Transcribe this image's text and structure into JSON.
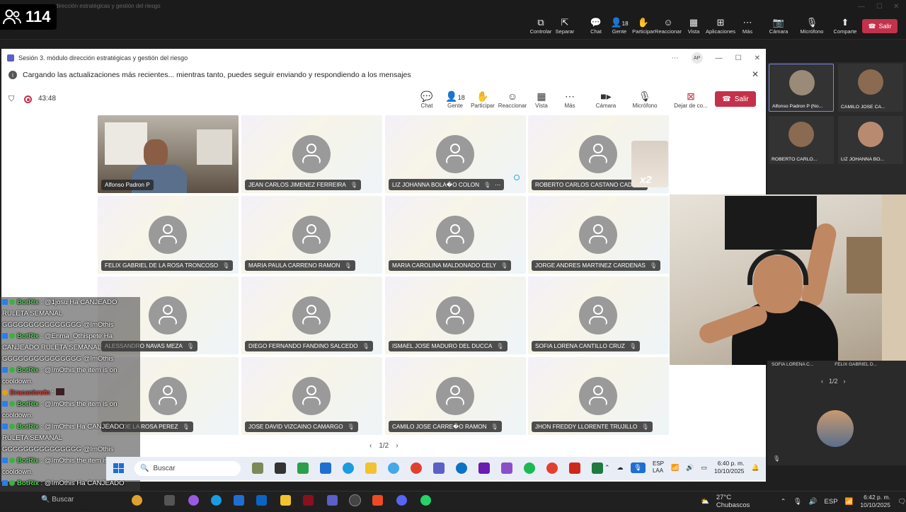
{
  "outer": {
    "title": "dirección estratégicas y gestión del riesgo",
    "viewer_count": "114",
    "tools": [
      {
        "label": "Controlar",
        "icon": "control-icon"
      },
      {
        "label": "Separar",
        "icon": "popout-icon"
      },
      {
        "label": "Chat",
        "icon": "chat-icon"
      },
      {
        "label": "Gente",
        "icon": "people-icon",
        "count": "18"
      },
      {
        "label": "Participar",
        "icon": "hand-icon"
      },
      {
        "label": "Reaccionar",
        "icon": "smile-icon"
      },
      {
        "label": "Vista",
        "icon": "grid-icon"
      },
      {
        "label": "Aplicaciones",
        "icon": "apps-icon"
      },
      {
        "label": "Más",
        "icon": "more-icon"
      },
      {
        "label": "Cámara",
        "icon": "camera-off-icon"
      },
      {
        "label": "Micrófono",
        "icon": "mic-off-icon"
      },
      {
        "label": "Comparte",
        "icon": "share-icon"
      }
    ],
    "exit_label": "Salir"
  },
  "meeting": {
    "title": "Sesión 3. módulo dirección estratégicas y gestión del riesgo",
    "initials": "AP",
    "notice": "Cargando las actualizaciones más recientes... mientras tanto, puedes seguir enviando y respondiendo a los mensajes",
    "timer": "43:48",
    "tools": [
      {
        "label": "Chat",
        "icon": "chat-icon"
      },
      {
        "label": "Gente",
        "icon": "people-icon",
        "count": "18"
      },
      {
        "label": "Participar",
        "icon": "hand-icon"
      },
      {
        "label": "Reaccionar",
        "icon": "smile-icon"
      },
      {
        "label": "Vista",
        "icon": "grid-icon"
      },
      {
        "label": "Más",
        "icon": "more-icon"
      },
      {
        "label": "Cámara",
        "icon": "camera-icon"
      },
      {
        "label": "Micrófono",
        "icon": "mic-icon"
      },
      {
        "label": "Dejar de co...",
        "icon": "stop-share-icon"
      }
    ],
    "exit_label": "Salir",
    "participants": [
      "Alfonso Padron P",
      "JEAN CARLOS JIMENEZ FERREIRA",
      "LIZ JOHANNA BOLA�O COLON",
      "ROBERTO CARLOS CASTANO CADENA",
      "FELIX GABRIEL DE LA ROSA TRONCOSO",
      "MARIA PAULA CARRENO RAMON",
      "MARIA CAROLINA MALDONADO CELY",
      "JORGE ANDRES MARTINEZ CARDENAS",
      "ALESSANDRO NAVAS MEZA",
      "DIEGO FERNANDO FANDINO SALCEDO",
      "ISMAEL JOSE MADURO DEL DUCCA",
      "SOFIA LORENA CANTILLO CRUZ",
      "ANIEL DE LA ROSA PEREZ",
      "JOSE DAVID VIZCAINO CAMARGO",
      "CAMILO JOSE CARRE�O RAMON",
      "JHON FREDDY LLORENTE TRUJILLO"
    ],
    "page": "1/2",
    "reaction_badge": "x2"
  },
  "side_panel": {
    "tiles": [
      "Alfonso Padron P (No...",
      "CAMILO JOSE CA...",
      "ROBERTO CARLO...",
      "LIZ JOHANNA BO..."
    ],
    "cam_labels": [
      "SOFIA LORENA C...",
      "FELIX GABRIEL D..."
    ],
    "page": "1/2"
  },
  "chat": [
    {
      "user": "BotRix",
      "kind": "bot",
      "text": ": @1josu Ha CANJEADO RULETA SEMANAL GGGGGGGGGGGGGGG @ImOthis"
    },
    {
      "user": "BotRix",
      "kind": "bot",
      "text": ": @Enma_Othispete Ha CANJEADO RULETA SEMANAL GGGGGGGGGGGGGGG @ImOthis"
    },
    {
      "user": "BotRix",
      "kind": "bot",
      "text": ": @ImOthis the item is on cooldown."
    },
    {
      "user": "Dracanhrefn",
      "kind": "user",
      "text": ":"
    },
    {
      "user": "BotRix",
      "kind": "bot",
      "text": ": @ImOthis the item is on cooldown."
    },
    {
      "user": "BotRix",
      "kind": "bot",
      "text": ": @ImOthis Ha CANJEADO RULETA SEMANAL GGGGGGGGGGGGGGG @ImOthis"
    },
    {
      "user": "BotRix",
      "kind": "bot",
      "text": ": @ImOthis the item is on cooldown."
    },
    {
      "user": "BotRix",
      "kind": "bot",
      "text": ": @ImOthis Ha CANJEADO RULETA SEMANAL GGGGGGGGGGGGGGG @ImOthis"
    }
  ],
  "inner_taskbar": {
    "search": "Buscar",
    "lang": "ESP",
    "lang2": "LAA",
    "time": "6:40 p. m.",
    "date": "10/10/2025"
  },
  "outer_taskbar": {
    "search": "Buscar",
    "weather": "27°C  Chubascos",
    "lang": "ESP",
    "time": "6:42 p. m.",
    "date": "10/10/2025"
  },
  "colors": {
    "exit_red": "#c4314b",
    "teams_purple": "#5b5fc7",
    "bot_green": "#5ad15a"
  }
}
